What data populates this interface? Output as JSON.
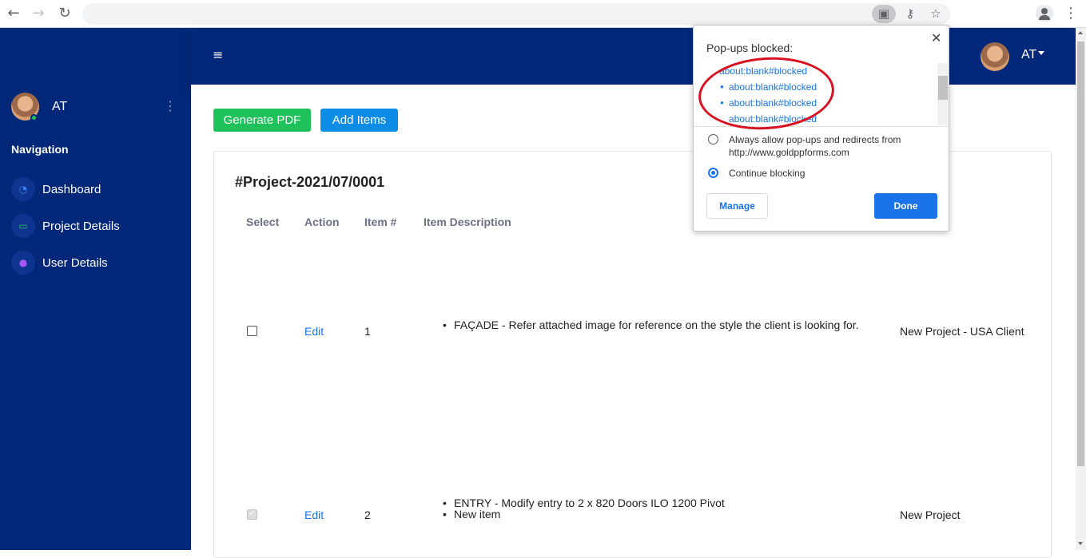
{
  "browser": {
    "icons": {
      "back": "back-arrow-icon",
      "forward": "forward-arrow-icon",
      "reload": "reload-icon",
      "popup_blocked": "popup-blocked-icon",
      "key": "key-icon",
      "star": "star-icon",
      "profile": "profile-icon",
      "menu": "kebab-menu-icon"
    }
  },
  "topbar": {
    "user_label": "AT"
  },
  "sidebar": {
    "user_name": "AT",
    "heading": "Navigation",
    "items": [
      {
        "label": "Dashboard",
        "icon": "dashboard-icon",
        "color": "#3b82f6"
      },
      {
        "label": "Project Details",
        "icon": "laptop-icon",
        "color": "#22c55e"
      },
      {
        "label": "User Details",
        "icon": "user-icon",
        "color": "#a855f7"
      }
    ]
  },
  "toolbar": {
    "generate_pdf_label": "Generate PDF",
    "add_items_label": "Add Items"
  },
  "project": {
    "title": "#Project-2021/07/0001",
    "columns": [
      "Select",
      "Action",
      "Item #",
      "Item Description"
    ],
    "rows": [
      {
        "checked": false,
        "action": "Edit",
        "item_no": "1",
        "description": [
          "FAÇADE - Refer attached image for reference on the style the client is looking for."
        ],
        "project": "New Project - USA Client"
      },
      {
        "checked": true,
        "action": "Edit",
        "item_no": "2",
        "description": [
          "ENTRY - Modify entry to 2 x 820 Doors ILO 1200 Pivot",
          "New item"
        ],
        "project": "New Project"
      }
    ]
  },
  "popup": {
    "title": "Pop-ups blocked:",
    "links": [
      "about:blank#blocked",
      "about:blank#blocked",
      "about:blank#blocked",
      "about:blank#blocked"
    ],
    "options": [
      {
        "label": "Always allow pop-ups and redirects from http://www.goldppforms.com",
        "selected": false
      },
      {
        "label": "Continue blocking",
        "selected": true
      }
    ],
    "manage_label": "Manage",
    "done_label": "Done"
  },
  "colors": {
    "navy": "#03287a",
    "green_button": "#1fc25a",
    "blue_button": "#0e8de6",
    "link": "#1a73e8",
    "annotation_red": "#d81020"
  }
}
